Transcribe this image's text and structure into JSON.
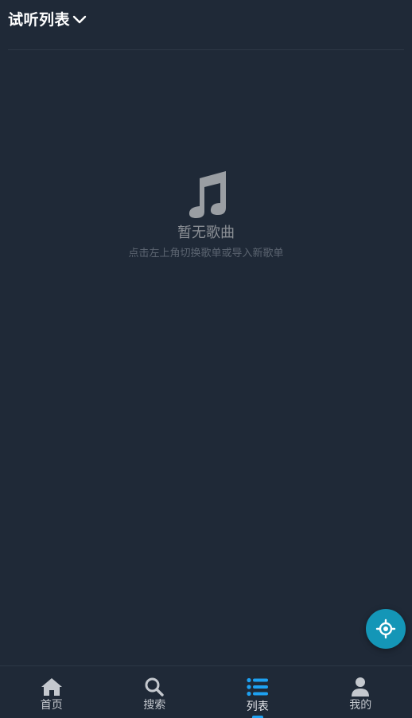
{
  "header": {
    "title": "试听列表",
    "dropdown_icon": "chevron-down-icon"
  },
  "empty_state": {
    "icon": "music-note-icon",
    "title": "暂无歌曲",
    "subtitle": "点击左上角切换歌单或导入新歌单"
  },
  "fab": {
    "icon": "locate-crosshair-icon",
    "color": "#1496b7"
  },
  "tabs": [
    {
      "label": "首页",
      "icon": "home-icon",
      "active": false
    },
    {
      "label": "搜索",
      "icon": "search-icon",
      "active": false
    },
    {
      "label": "列表",
      "icon": "list-icon",
      "active": true
    },
    {
      "label": "我的",
      "icon": "user-icon",
      "active": false
    }
  ],
  "colors": {
    "background": "#1f2937",
    "accent": "#1ea1f2",
    "muted_text": "#8b8f95"
  }
}
